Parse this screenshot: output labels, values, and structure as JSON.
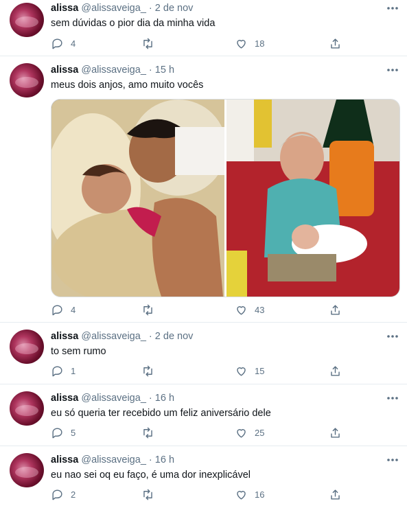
{
  "tweets": [
    {
      "name": "alissa",
      "handle": "@alissaveiga_",
      "separator": "·",
      "time": "2 de nov",
      "text": "sem dúvidas o pior dia da minha vida",
      "replies": "4",
      "retweets": "",
      "likes": "18"
    },
    {
      "name": "alissa",
      "handle": "@alissaveiga_",
      "separator": "·",
      "time": "15 h",
      "text": "meus dois anjos, amo muito vocês",
      "replies": "4",
      "retweets": "",
      "likes": "43"
    },
    {
      "name": "alissa",
      "handle": "@alissaveiga_",
      "separator": "·",
      "time": "2 de nov",
      "text": "to sem rumo",
      "replies": "1",
      "retweets": "",
      "likes": "15"
    },
    {
      "name": "alissa",
      "handle": "@alissaveiga_",
      "separator": "·",
      "time": "16 h",
      "text": "eu só queria ter recebido um feliz aniversário dele",
      "replies": "5",
      "retweets": "",
      "likes": "25"
    },
    {
      "name": "alissa",
      "handle": "@alissaveiga_",
      "separator": "·",
      "time": "16 h",
      "text": "eu nao sei oq eu faço, é uma dor inexplicável",
      "replies": "2",
      "retweets": "",
      "likes": "16"
    }
  ],
  "icons": {
    "reply": "reply-icon",
    "retweet": "retweet-icon",
    "like": "heart-icon",
    "share": "share-icon",
    "more": "more-icon"
  },
  "colors": {
    "text": "#0f1419",
    "secondary": "#5b7083",
    "divider": "#e6ecf0"
  }
}
